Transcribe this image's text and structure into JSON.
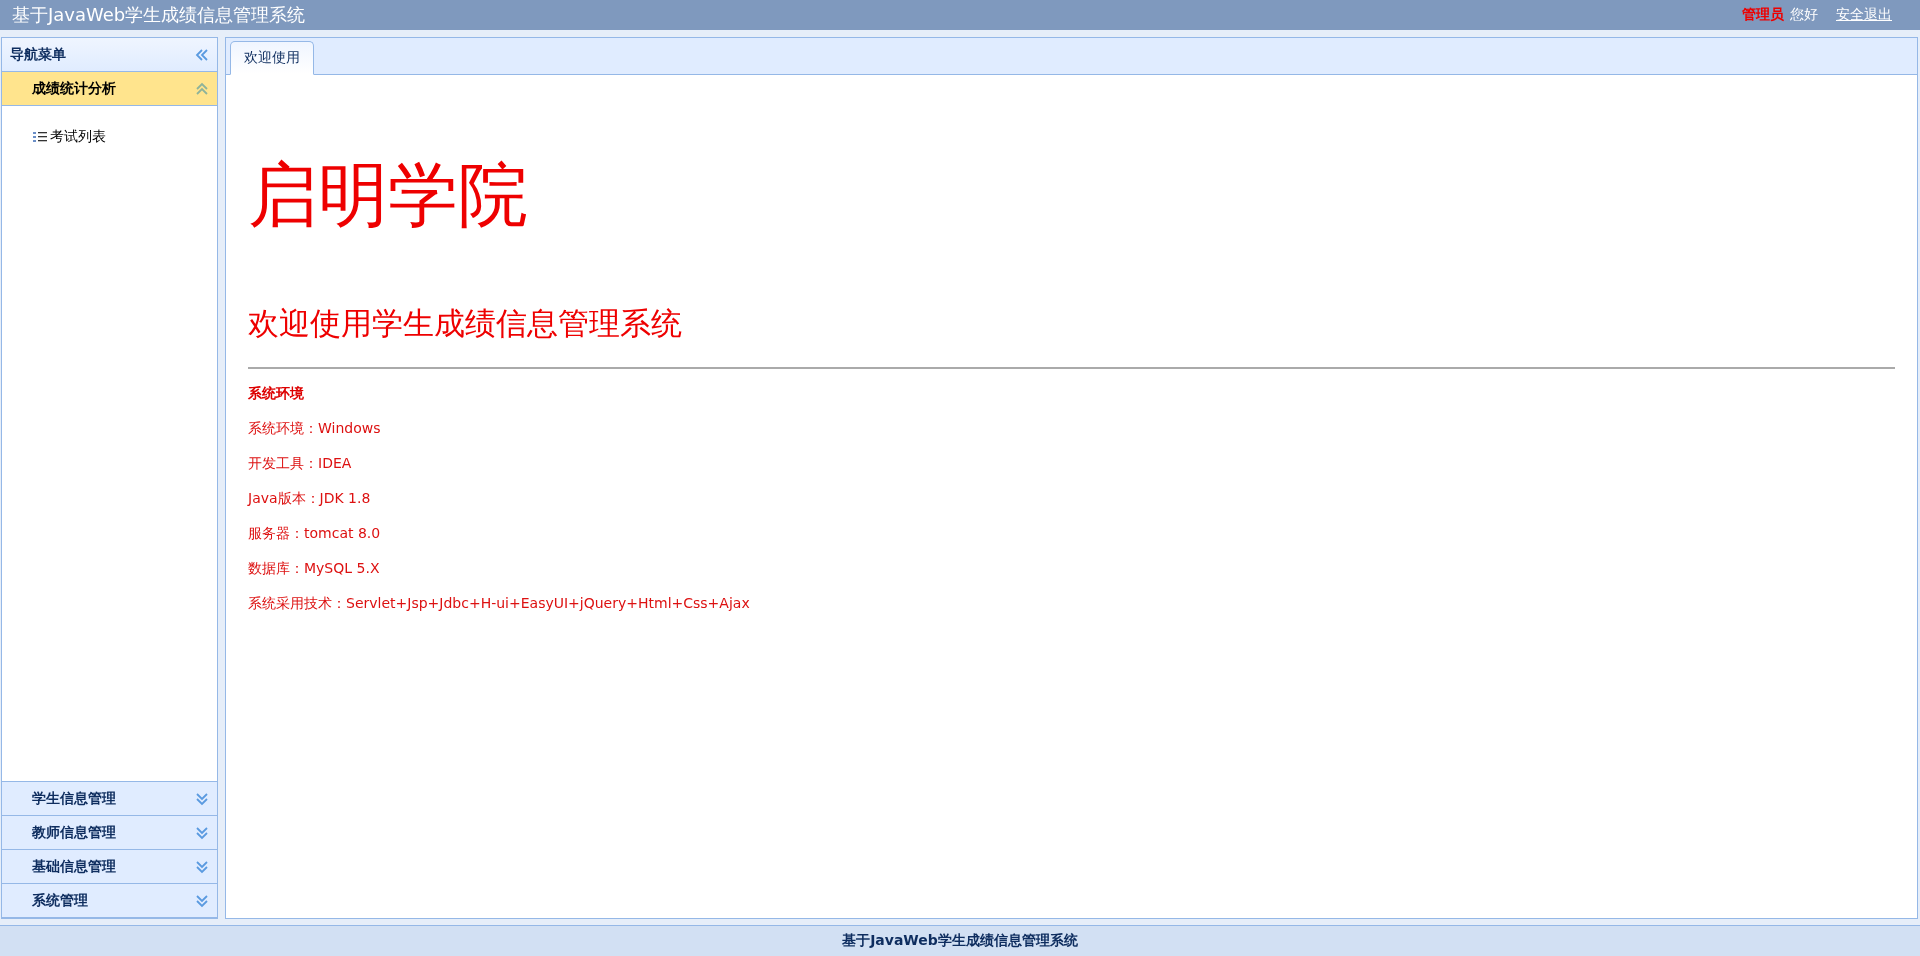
{
  "header": {
    "title": "基于JavaWeb学生成绩信息管理系统",
    "user_role": "管理员",
    "greeting": "您好",
    "logout": "安全退出"
  },
  "sidebar": {
    "title": "导航菜单",
    "sections": [
      {
        "label": "成绩统计分析",
        "expanded": true,
        "items": [
          {
            "label": "考试列表"
          }
        ]
      },
      {
        "label": "学生信息管理",
        "expanded": false
      },
      {
        "label": "教师信息管理",
        "expanded": false
      },
      {
        "label": "基础信息管理",
        "expanded": false
      },
      {
        "label": "系统管理",
        "expanded": false
      }
    ]
  },
  "tabs": [
    {
      "label": "欢迎使用",
      "selected": true
    }
  ],
  "content": {
    "school": "启明学院",
    "welcome": "欢迎使用学生成绩信息管理系统",
    "section_title": "系统环境",
    "lines": [
      "系统环境：Windows",
      "开发工具：IDEA",
      "Java版本：JDK 1.8",
      "服务器：tomcat 8.0",
      "数据库：MySQL 5.X",
      "系统采用技术：Servlet+Jsp+Jdbc+H-ui+EasyUI+jQuery+Html+Css+Ajax"
    ]
  },
  "footer": "基于JavaWeb学生成绩信息管理系统"
}
